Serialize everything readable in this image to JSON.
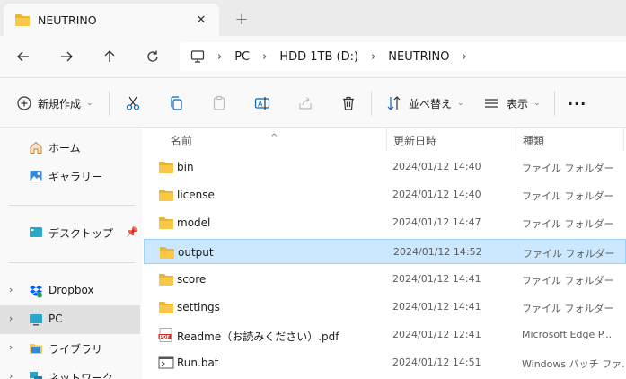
{
  "tab": {
    "title": "NEUTRINO",
    "close": "✕",
    "new_tab": "+"
  },
  "address": {
    "crumbs": [
      "PC",
      "HDD 1TB (D:)",
      "NEUTRINO"
    ]
  },
  "toolbar": {
    "new_label": "新規作成",
    "sort_label": "並べ替え",
    "view_label": "表示",
    "more_label": "···"
  },
  "sidebar": {
    "home": "ホーム",
    "gallery": "ギャラリー",
    "desktop": "デスクトップ",
    "dropbox": "Dropbox",
    "pc": "PC",
    "library": "ライブラリ",
    "network": "ネットワーク"
  },
  "columns": {
    "name": "名前",
    "date": "更新日時",
    "type": "種類"
  },
  "files": [
    {
      "name": "bin",
      "date": "2024/01/12 14:40",
      "type": "ファイル フォルダー",
      "icon": "folder-icon"
    },
    {
      "name": "license",
      "date": "2024/01/12 14:40",
      "type": "ファイル フォルダー",
      "icon": "folder-icon"
    },
    {
      "name": "model",
      "date": "2024/01/12 14:47",
      "type": "ファイル フォルダー",
      "icon": "folder-icon"
    },
    {
      "name": "output",
      "date": "2024/01/12 14:52",
      "type": "ファイル フォルダー",
      "icon": "folder-icon",
      "selected": true
    },
    {
      "name": "score",
      "date": "2024/01/12 14:41",
      "type": "ファイル フォルダー",
      "icon": "folder-icon"
    },
    {
      "name": "settings",
      "date": "2024/01/12 14:41",
      "type": "ファイル フォルダー",
      "icon": "folder-icon"
    },
    {
      "name": "Readme（お読みください）.pdf",
      "date": "2024/01/12 12:41",
      "type": "Microsoft Edge P...",
      "icon": "pdf-icon"
    },
    {
      "name": "Run.bat",
      "date": "2024/01/12 14:51",
      "type": "Windows バッチ ファ...",
      "icon": "bat-icon"
    }
  ],
  "colors": {
    "selection": "#cce8ff",
    "folder": "#f8c846",
    "accent": "#0067c0"
  }
}
